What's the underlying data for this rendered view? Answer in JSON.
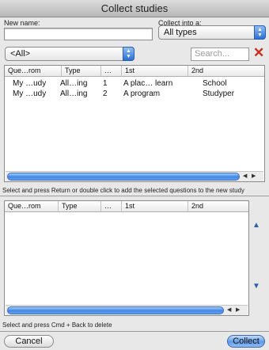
{
  "window": {
    "title": "Collect studies"
  },
  "form": {
    "new_name_label": "New name:",
    "new_name_value": "",
    "collect_into_label": "Collect into a:",
    "collect_into_value": "All types"
  },
  "filter": {
    "value": "<All>"
  },
  "search": {
    "placeholder": "Search..."
  },
  "top_table": {
    "columns": [
      "Que…rom",
      "Type",
      "…",
      "1st",
      "2nd"
    ],
    "rows": [
      [
        "My …udy",
        "All…ing",
        "1",
        "A plac… learn",
        "School"
      ],
      [
        "My …udy",
        "All…ing",
        "2",
        "A program",
        "Studyper"
      ]
    ],
    "hint": "Select and press Return or double click to add the selected questions to the new study"
  },
  "bottom_table": {
    "columns": [
      "Que…rom",
      "Type",
      "…",
      "1st",
      "2nd"
    ],
    "rows": [],
    "hint": "Select and press Cmd + Back to delete"
  },
  "icons": {
    "stepper": "up-down-arrows-icon",
    "clear": "red-x-icon",
    "move_up": "triangle-up-icon",
    "move_down": "triangle-down-icon"
  },
  "colors": {
    "accent": "#3f86e6",
    "clear": "#cc2a1c"
  },
  "buttons": {
    "cancel": "Cancel",
    "collect": "Collect"
  }
}
